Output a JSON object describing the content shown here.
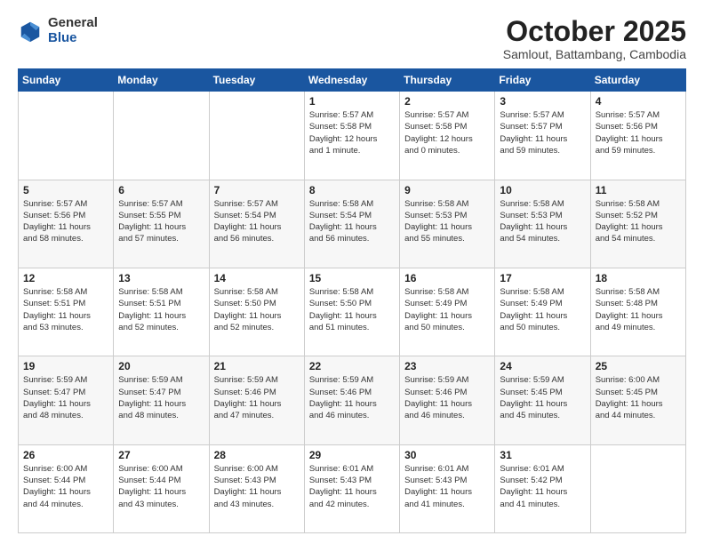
{
  "logo": {
    "general": "General",
    "blue": "Blue"
  },
  "title": "October 2025",
  "subtitle": "Samlout, Battambang, Cambodia",
  "days_header": [
    "Sunday",
    "Monday",
    "Tuesday",
    "Wednesday",
    "Thursday",
    "Friday",
    "Saturday"
  ],
  "weeks": [
    [
      {
        "day": "",
        "info": ""
      },
      {
        "day": "",
        "info": ""
      },
      {
        "day": "",
        "info": ""
      },
      {
        "day": "1",
        "info": "Sunrise: 5:57 AM\nSunset: 5:58 PM\nDaylight: 12 hours\nand 1 minute."
      },
      {
        "day": "2",
        "info": "Sunrise: 5:57 AM\nSunset: 5:58 PM\nDaylight: 12 hours\nand 0 minutes."
      },
      {
        "day": "3",
        "info": "Sunrise: 5:57 AM\nSunset: 5:57 PM\nDaylight: 11 hours\nand 59 minutes."
      },
      {
        "day": "4",
        "info": "Sunrise: 5:57 AM\nSunset: 5:56 PM\nDaylight: 11 hours\nand 59 minutes."
      }
    ],
    [
      {
        "day": "5",
        "info": "Sunrise: 5:57 AM\nSunset: 5:56 PM\nDaylight: 11 hours\nand 58 minutes."
      },
      {
        "day": "6",
        "info": "Sunrise: 5:57 AM\nSunset: 5:55 PM\nDaylight: 11 hours\nand 57 minutes."
      },
      {
        "day": "7",
        "info": "Sunrise: 5:57 AM\nSunset: 5:54 PM\nDaylight: 11 hours\nand 56 minutes."
      },
      {
        "day": "8",
        "info": "Sunrise: 5:58 AM\nSunset: 5:54 PM\nDaylight: 11 hours\nand 56 minutes."
      },
      {
        "day": "9",
        "info": "Sunrise: 5:58 AM\nSunset: 5:53 PM\nDaylight: 11 hours\nand 55 minutes."
      },
      {
        "day": "10",
        "info": "Sunrise: 5:58 AM\nSunset: 5:53 PM\nDaylight: 11 hours\nand 54 minutes."
      },
      {
        "day": "11",
        "info": "Sunrise: 5:58 AM\nSunset: 5:52 PM\nDaylight: 11 hours\nand 54 minutes."
      }
    ],
    [
      {
        "day": "12",
        "info": "Sunrise: 5:58 AM\nSunset: 5:51 PM\nDaylight: 11 hours\nand 53 minutes."
      },
      {
        "day": "13",
        "info": "Sunrise: 5:58 AM\nSunset: 5:51 PM\nDaylight: 11 hours\nand 52 minutes."
      },
      {
        "day": "14",
        "info": "Sunrise: 5:58 AM\nSunset: 5:50 PM\nDaylight: 11 hours\nand 52 minutes."
      },
      {
        "day": "15",
        "info": "Sunrise: 5:58 AM\nSunset: 5:50 PM\nDaylight: 11 hours\nand 51 minutes."
      },
      {
        "day": "16",
        "info": "Sunrise: 5:58 AM\nSunset: 5:49 PM\nDaylight: 11 hours\nand 50 minutes."
      },
      {
        "day": "17",
        "info": "Sunrise: 5:58 AM\nSunset: 5:49 PM\nDaylight: 11 hours\nand 50 minutes."
      },
      {
        "day": "18",
        "info": "Sunrise: 5:58 AM\nSunset: 5:48 PM\nDaylight: 11 hours\nand 49 minutes."
      }
    ],
    [
      {
        "day": "19",
        "info": "Sunrise: 5:59 AM\nSunset: 5:47 PM\nDaylight: 11 hours\nand 48 minutes."
      },
      {
        "day": "20",
        "info": "Sunrise: 5:59 AM\nSunset: 5:47 PM\nDaylight: 11 hours\nand 48 minutes."
      },
      {
        "day": "21",
        "info": "Sunrise: 5:59 AM\nSunset: 5:46 PM\nDaylight: 11 hours\nand 47 minutes."
      },
      {
        "day": "22",
        "info": "Sunrise: 5:59 AM\nSunset: 5:46 PM\nDaylight: 11 hours\nand 46 minutes."
      },
      {
        "day": "23",
        "info": "Sunrise: 5:59 AM\nSunset: 5:46 PM\nDaylight: 11 hours\nand 46 minutes."
      },
      {
        "day": "24",
        "info": "Sunrise: 5:59 AM\nSunset: 5:45 PM\nDaylight: 11 hours\nand 45 minutes."
      },
      {
        "day": "25",
        "info": "Sunrise: 6:00 AM\nSunset: 5:45 PM\nDaylight: 11 hours\nand 44 minutes."
      }
    ],
    [
      {
        "day": "26",
        "info": "Sunrise: 6:00 AM\nSunset: 5:44 PM\nDaylight: 11 hours\nand 44 minutes."
      },
      {
        "day": "27",
        "info": "Sunrise: 6:00 AM\nSunset: 5:44 PM\nDaylight: 11 hours\nand 43 minutes."
      },
      {
        "day": "28",
        "info": "Sunrise: 6:00 AM\nSunset: 5:43 PM\nDaylight: 11 hours\nand 43 minutes."
      },
      {
        "day": "29",
        "info": "Sunrise: 6:01 AM\nSunset: 5:43 PM\nDaylight: 11 hours\nand 42 minutes."
      },
      {
        "day": "30",
        "info": "Sunrise: 6:01 AM\nSunset: 5:43 PM\nDaylight: 11 hours\nand 41 minutes."
      },
      {
        "day": "31",
        "info": "Sunrise: 6:01 AM\nSunset: 5:42 PM\nDaylight: 11 hours\nand 41 minutes."
      },
      {
        "day": "",
        "info": ""
      }
    ]
  ]
}
